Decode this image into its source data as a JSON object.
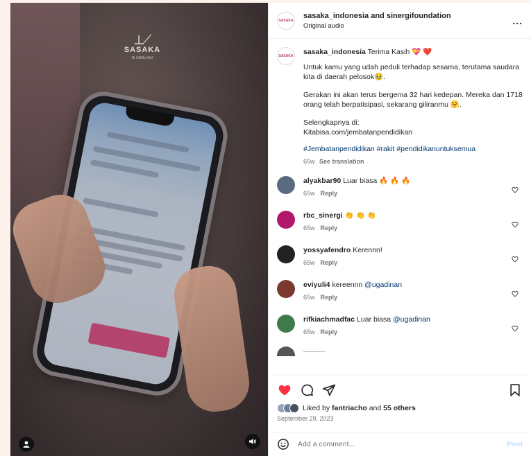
{
  "header": {
    "names": "sasaka_indonesia and sinergifoundation",
    "audio": "Original audio",
    "more_label": "..."
  },
  "watermark": {
    "mark": "⟂⟋",
    "text": "SASAKA",
    "sub": "⊕ SINERGI"
  },
  "caption": {
    "username": "sasaka_indonesia",
    "first": "Terima Kasih 💝 ❤️",
    "p1": "Untuk kamu yang udah peduli terhadap sesama, terutama saudara kita di daerah pelosok🥹.",
    "p2": "Gerakan ini akan terus bergema 32 hari kedepan. Mereka dan 1718 orang telah berpatisipasi, sekarang giliranmu 🤗.",
    "p3a": "Selengkapnya di:",
    "p3b": "Kitabisa.com/jembatanpendidikan",
    "hashtags": "#Jembatanpendidikan #rakit #pendidikanuntuksemua",
    "time": "65w",
    "translate": "See translation"
  },
  "comments": [
    {
      "user": "alyakbar90",
      "text": "Luar biasa",
      "emoji": "🔥 🔥 🔥",
      "mention": "",
      "time": "65w",
      "reply": "Reply",
      "avatar_color": "#5a6b80"
    },
    {
      "user": "rbc_sinergi",
      "text": "",
      "emoji": "👏 👏 👏",
      "mention": "",
      "time": "65w",
      "reply": "Reply",
      "avatar_color": "#b0186b"
    },
    {
      "user": "yossyafendro",
      "text": "Kerennn!",
      "emoji": "",
      "mention": "",
      "time": "65w",
      "reply": "Reply",
      "avatar_color": "#222222"
    },
    {
      "user": "eviyuli4",
      "text": "kereennn",
      "emoji": "",
      "mention": "@ugadinan",
      "time": "65w",
      "reply": "Reply",
      "avatar_color": "#7a3a30"
    },
    {
      "user": "rifkiachmadfac",
      "text": "Luar biasa",
      "emoji": "",
      "mention": "@ugadinan",
      "time": "65w",
      "reply": "Reply",
      "avatar_color": "#3f7a4a"
    }
  ],
  "likes": {
    "prefix": "Liked by",
    "user": "fantriacho",
    "and": "and",
    "others": "55 others"
  },
  "date": "September 29, 2023",
  "add_comment": {
    "placeholder": "Add a comment...",
    "post": "Post"
  },
  "colors": {
    "heart": "#ff3040",
    "link": "#00376b",
    "muted": "#737373",
    "post": "#c0dffd"
  }
}
